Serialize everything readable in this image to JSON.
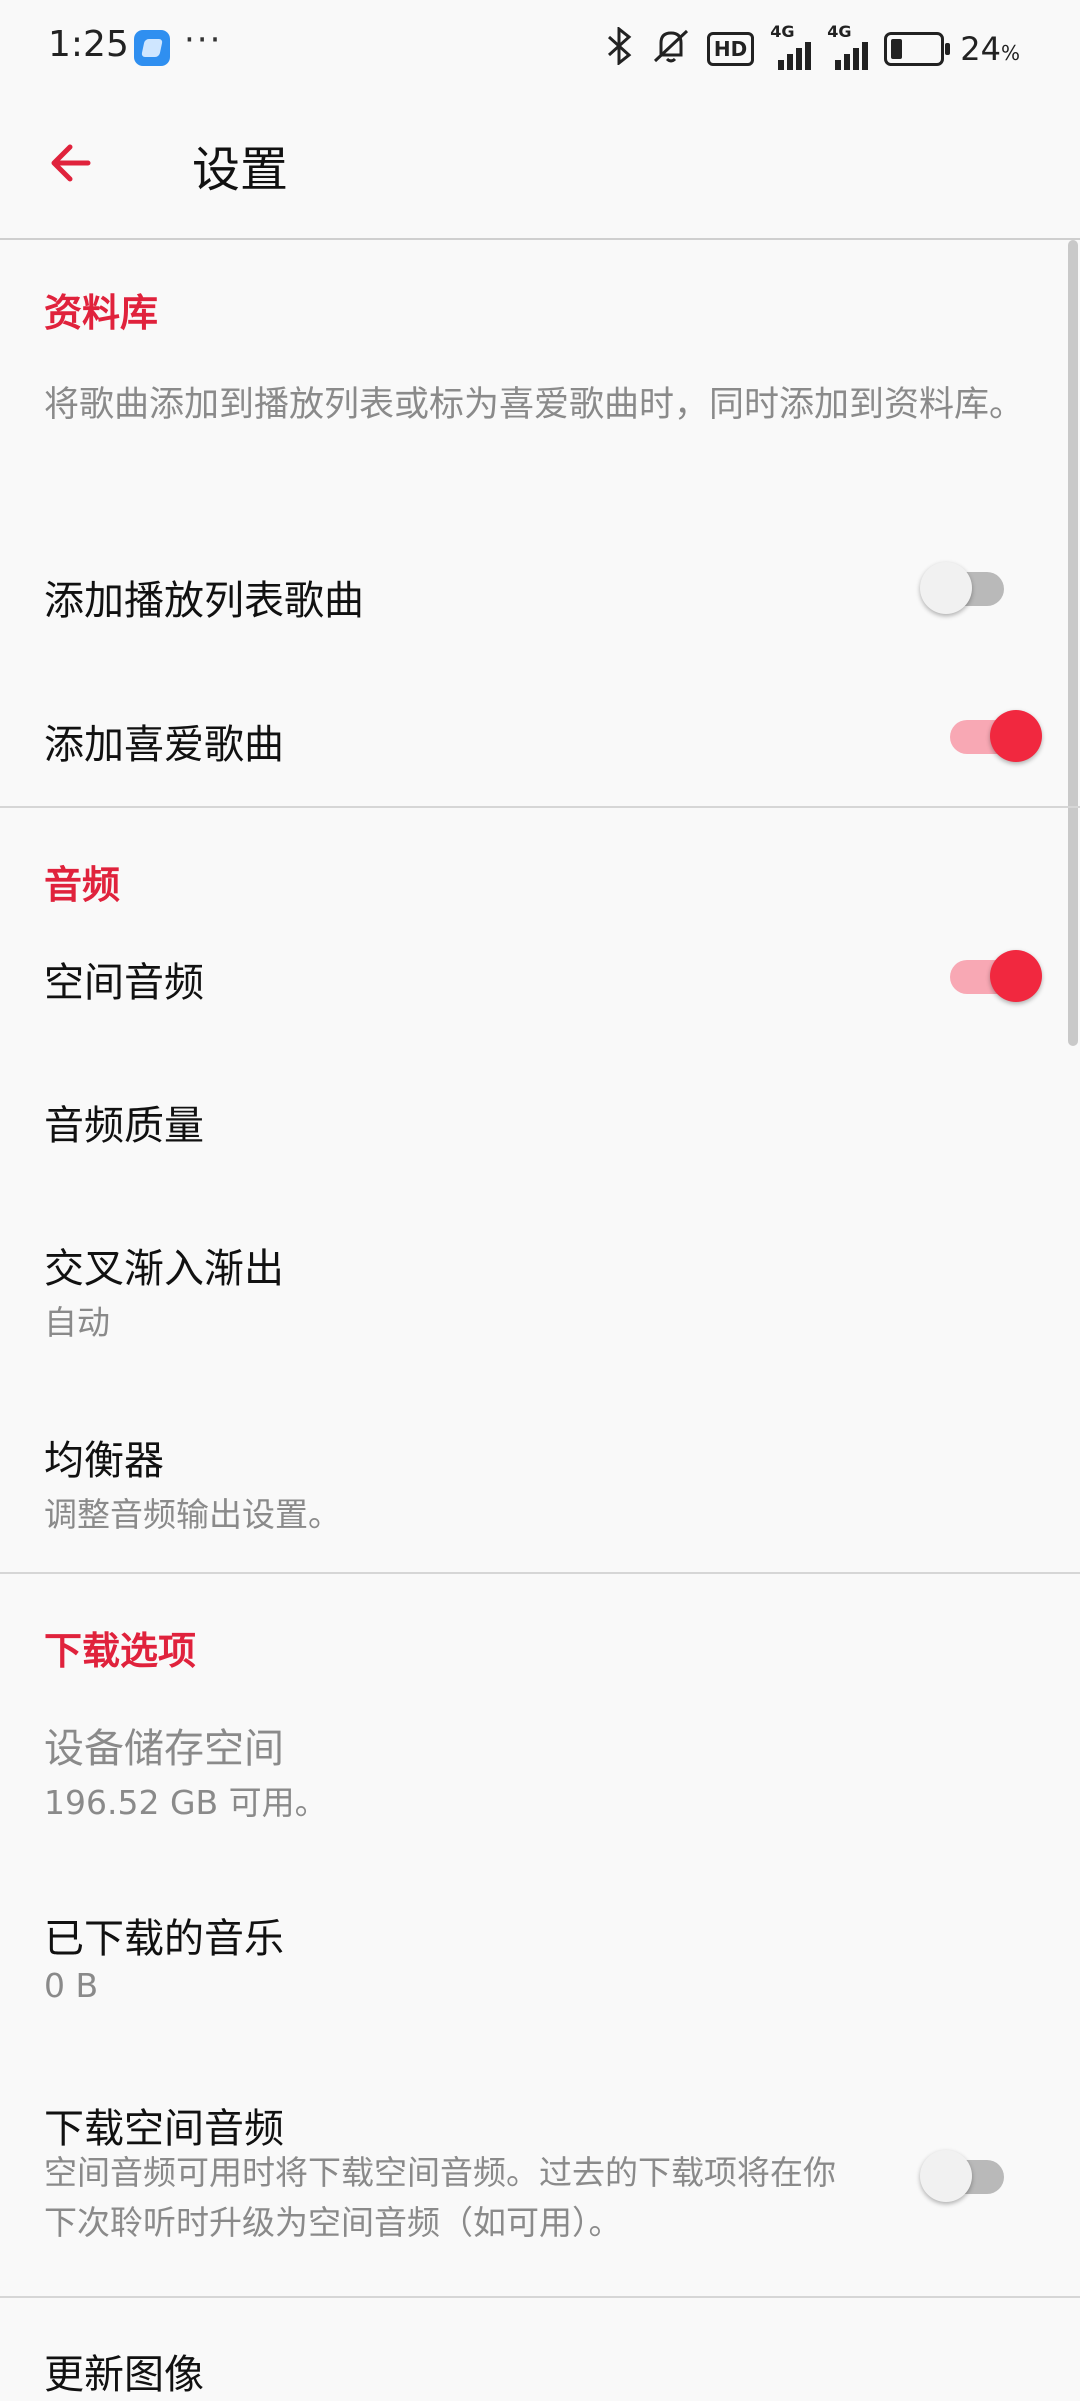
{
  "status_bar": {
    "time": "1:25",
    "more": "···",
    "network_hd": "HD",
    "network_label_1": "4G",
    "network_label_2": "4G",
    "battery_percent": "24",
    "battery_unit": "%",
    "battery_level": 0.24
  },
  "header": {
    "title": "设置",
    "back_icon": "arrow-left-icon",
    "accent_color": "#e0223c"
  },
  "sections": {
    "library": {
      "header": "资料库",
      "description": "将歌曲添加到播放列表或标为喜爱歌曲时，同时添加到资料库。",
      "add_playlist_songs": {
        "label": "添加播放列表歌曲",
        "on": false
      },
      "add_favorite_songs": {
        "label": "添加喜爱歌曲",
        "on": true
      }
    },
    "audio": {
      "header": "音频",
      "spatial_audio": {
        "label": "空间音频",
        "on": true
      },
      "audio_quality": {
        "label": "音频质量"
      },
      "crossfade": {
        "label": "交叉渐入渐出",
        "value": "自动"
      },
      "equalizer": {
        "label": "均衡器",
        "description": "调整音频输出设置。"
      }
    },
    "downloads": {
      "header": "下载选项",
      "device_storage": {
        "label": "设备储存空间",
        "value": "196.52 GB 可用。"
      },
      "downloaded_music": {
        "label": "已下载的音乐",
        "value": "0 B"
      },
      "download_spatial": {
        "label": "下载空间音频",
        "description": "空间音频可用时将下载空间音频。过去的下载项将在你下次聆听时升级为空间音频（如可用）。",
        "on": false
      },
      "update_images": {
        "label": "更新图像"
      }
    }
  }
}
